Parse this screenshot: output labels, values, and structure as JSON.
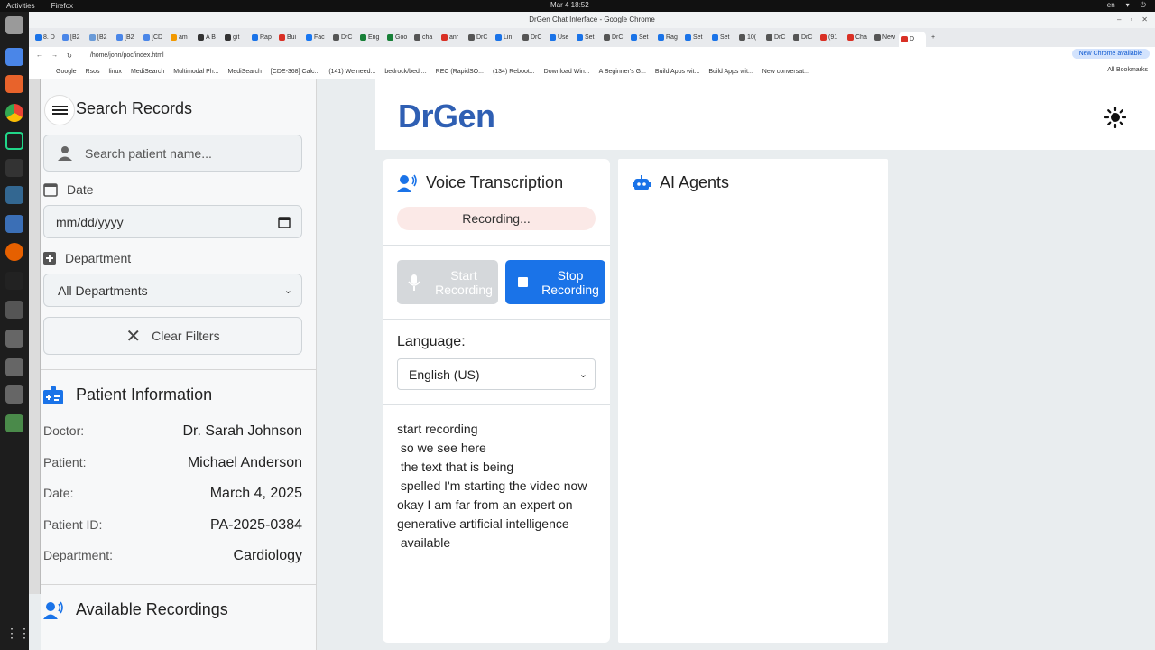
{
  "system": {
    "activities": "Activities",
    "app_name": "Firefox",
    "clock": "Mar 4  18:52",
    "lang": "en"
  },
  "browser": {
    "window_title": "DrGen Chat Interface - Google Chrome",
    "tabs": [
      "8. D",
      "[B2",
      "[B2",
      "[B2",
      "[CD",
      "am",
      "A B",
      "git",
      "Rap",
      "Bui",
      "Fac",
      "DrC",
      "Eng",
      "Goo",
      "cha",
      "anr",
      "DrC",
      "Lin",
      "DrC",
      "Use",
      "Set",
      "DrC",
      "Set",
      "Rag",
      "Set",
      "Set",
      "10(",
      "DrC",
      "DrC",
      "(91",
      "Cha",
      "New",
      "D"
    ],
    "url": "/home/john/poc/index.html",
    "update_label": "New Chrome available",
    "bookmarks": [
      "Google",
      "Rsos",
      "linux",
      "MediSearch",
      "Multimodal Ph...",
      "MediSearch",
      "[CDE-368] Calc...",
      "(141) We need...",
      "bedrock/bedr...",
      "REC (RapidSO...",
      "(134) Reboot...",
      "Download Win...",
      "A Beginner's G...",
      "Build Apps wit...",
      "Build Apps wit...",
      "New conversat..."
    ],
    "all_bookmarks": "All Bookmarks"
  },
  "sidebar": {
    "search_title": "Search Records",
    "search_placeholder": "Search patient name...",
    "date_label": "Date",
    "date_placeholder": "mm/dd/yyyy",
    "department_label": "Department",
    "department_value": "All Departments",
    "clear_label": "Clear Filters",
    "patient_info_title": "Patient Information",
    "patient_info": {
      "doctor_key": "Doctor:",
      "doctor": "Dr. Sarah Johnson",
      "patient_key": "Patient:",
      "patient": "Michael Anderson",
      "date_key": "Date:",
      "date": "March 4, 2025",
      "id_key": "Patient ID:",
      "id": "PA-2025-0384",
      "dept_key": "Department:",
      "dept": "Cardiology"
    },
    "recordings_title": "Available Recordings"
  },
  "main": {
    "logo": "DrGen",
    "voice": {
      "title": "Voice Transcription",
      "status": "Recording...",
      "start_label_1": "Start",
      "start_label_2": "Recording",
      "stop_label_1": "Stop",
      "stop_label_2": "Recording",
      "language_label": "Language:",
      "language_value": "English (US)",
      "transcript": [
        "start recording",
        " so we see here",
        " the text that is being",
        " spelled I'm starting the video now",
        "okay I am far from an expert on",
        "generative artificial intelligence",
        " available"
      ]
    },
    "agents": {
      "title": "AI Agents"
    }
  },
  "colors": {
    "accent": "#1a73e8",
    "logo": "#2f5fb3",
    "status_bg": "#fbe9e7",
    "disabled": "#d5d8db"
  }
}
